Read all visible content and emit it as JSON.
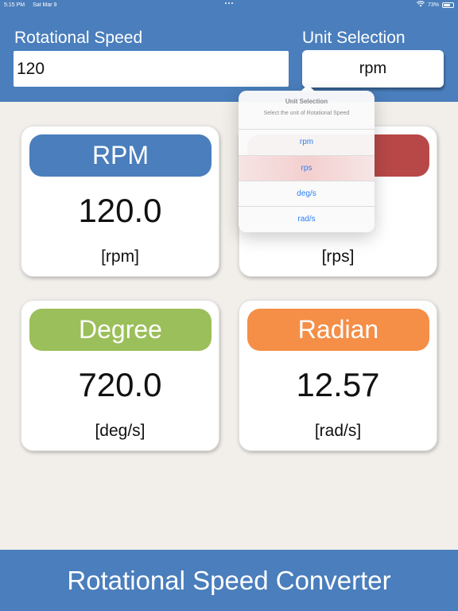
{
  "status_bar": {
    "time": "5:15 PM",
    "date": "Sat Mar 9",
    "battery_percent": "73%",
    "battery_level": 0.73
  },
  "header": {
    "speed_label": "Rotational Speed",
    "speed_value": "120",
    "unit_label": "Unit Selection",
    "unit_button": "rpm"
  },
  "cards": {
    "rpm": {
      "title": "RPM",
      "value": "120.0",
      "unit": "[rpm]",
      "color": "#4a7ebc"
    },
    "rps": {
      "title": "",
      "value": "",
      "unit": "[rps]",
      "color": "#b84848"
    },
    "deg": {
      "title": "Degree",
      "value": "720.0",
      "unit": "[deg/s]",
      "color": "#9bbf5a"
    },
    "rad": {
      "title": "Radian",
      "value": "12.57",
      "unit": "[rad/s]",
      "color": "#f58e47"
    }
  },
  "popover": {
    "title": "Unit Selection",
    "message": "Select the unit of Rotational Speed",
    "options": [
      "rpm",
      "rps",
      "deg/s",
      "rad/s"
    ]
  },
  "footer": {
    "title": "Rotational Speed Converter"
  },
  "colors": {
    "header_blue": "#4a7ebc",
    "background": "#f2efea",
    "link_blue": "#2a7ff6"
  }
}
